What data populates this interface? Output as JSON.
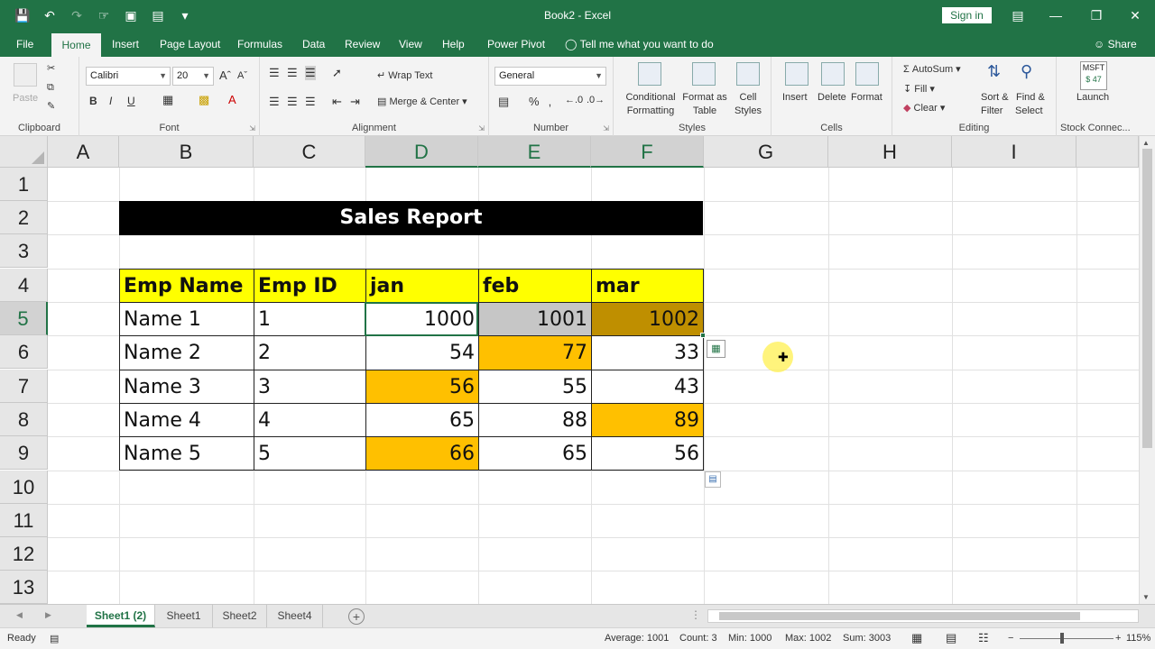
{
  "window": {
    "title": "Book2 - Excel",
    "signin_label": "Sign in"
  },
  "menu": {
    "tabs": [
      "File",
      "Home",
      "Insert",
      "Page Layout",
      "Formulas",
      "Data",
      "Review",
      "View",
      "Help",
      "Power Pivot"
    ],
    "active_tab": "Home",
    "tell_me": "Tell me what you want to do",
    "share": "Share"
  },
  "ribbon": {
    "clipboard": {
      "paste": "Paste",
      "label": "Clipboard"
    },
    "font": {
      "name": "Calibri",
      "size": "20",
      "bold": "B",
      "italic": "I",
      "underline": "U",
      "label": "Font"
    },
    "alignment": {
      "wrap_text": "Wrap Text",
      "merge_center": "Merge & Center",
      "label": "Alignment"
    },
    "number": {
      "format": "General",
      "percent": "%",
      "label": "Number"
    },
    "styles": {
      "conditional_formatting": [
        "Conditional",
        "Formatting"
      ],
      "format_as_table": [
        "Format as",
        "Table"
      ],
      "cell_styles": [
        "Cell",
        "Styles"
      ],
      "label": "Styles"
    },
    "cells": {
      "insert": "Insert",
      "delete": "Delete",
      "format": "Format",
      "label": "Cells"
    },
    "editing": {
      "autosum": "AutoSum",
      "fill": "Fill",
      "clear": "Clear",
      "sort_filter": [
        "Sort &",
        "Filter"
      ],
      "find_select": [
        "Find &",
        "Select"
      ],
      "label": "Editing"
    },
    "stock": {
      "ticker": "MSFT",
      "price": "$ 47",
      "launch": "Launch",
      "label": "Stock Connec..."
    }
  },
  "sheet": {
    "columns": [
      "A",
      "B",
      "C",
      "D",
      "E",
      "F",
      "G",
      "H",
      "I"
    ],
    "rows": [
      "1",
      "2",
      "3",
      "4",
      "5",
      "6",
      "7",
      "8",
      "9",
      "10",
      "11",
      "12",
      "13"
    ],
    "selected_row": "5",
    "selected_columns": [
      "D",
      "E",
      "F"
    ],
    "report_title": "Sales Report",
    "headers": [
      "Emp Name",
      "Emp ID",
      "jan",
      "feb",
      "mar"
    ],
    "data": [
      [
        "Name 1",
        "1",
        "1000",
        "1001",
        "1002"
      ],
      [
        "Name 2",
        "2",
        "54",
        "77",
        "33"
      ],
      [
        "Name 3",
        "3",
        "56",
        "55",
        "43"
      ],
      [
        "Name 4",
        "4",
        "65",
        "88",
        "89"
      ],
      [
        "Name 5",
        "5",
        "66",
        "65",
        "56"
      ]
    ],
    "highlight_colors": {
      "header_fill": "#ffff00",
      "title_fill": "#000000",
      "max_highlight": "#ffc000",
      "e5_fill": "#c6c6c6",
      "f5_fill": "#bf8f00"
    }
  },
  "sheet_tabs": [
    "Sheet1 (2)",
    "Sheet1",
    "Sheet2",
    "Sheet4"
  ],
  "active_sheet": "Sheet1 (2)",
  "status": {
    "mode": "Ready",
    "average": "Average: 1001",
    "count": "Count: 3",
    "min": "Min: 1000",
    "max": "Max: 1002",
    "sum": "Sum: 3003",
    "zoom": "115%"
  }
}
